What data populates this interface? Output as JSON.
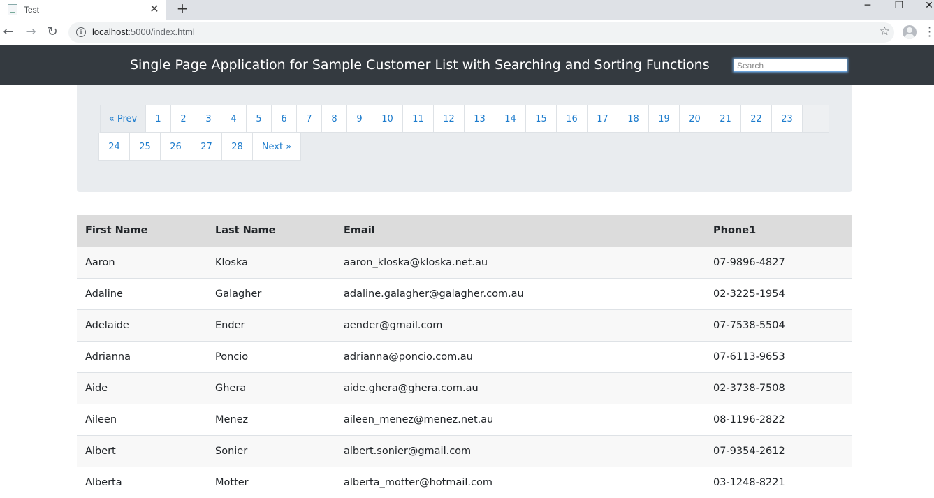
{
  "browser": {
    "tab_title": "Test",
    "new_tab_label": "+",
    "url_host": "localhost",
    "url_path": ":5000/index.html"
  },
  "app": {
    "title": "Single Page Application for Sample Customer List with Searching and Sorting Functions",
    "search_placeholder": "Search"
  },
  "pagination": {
    "row1": [
      "« Prev",
      "1",
      "2",
      "3",
      "4",
      "5",
      "6",
      "7",
      "8",
      "9",
      "10",
      "11",
      "12",
      "13",
      "14",
      "15",
      "16",
      "17",
      "18",
      "19",
      "20",
      "21",
      "22",
      "23"
    ],
    "row2": [
      "24",
      "25",
      "26",
      "27",
      "28",
      "Next »"
    ]
  },
  "table": {
    "columns": [
      "First Name",
      "Last Name",
      "Email",
      "Phone1"
    ],
    "rows": [
      [
        "Aaron",
        "Kloska",
        "aaron_kloska@kloska.net.au",
        "07-9896-4827"
      ],
      [
        "Adaline",
        "Galagher",
        "adaline.galagher@galagher.com.au",
        "02-3225-1954"
      ],
      [
        "Adelaide",
        "Ender",
        "aender@gmail.com",
        "07-7538-5504"
      ],
      [
        "Adrianna",
        "Poncio",
        "adrianna@poncio.com.au",
        "07-6113-9653"
      ],
      [
        "Aide",
        "Ghera",
        "aide.ghera@ghera.com.au",
        "02-3738-7508"
      ],
      [
        "Aileen",
        "Menez",
        "aileen_menez@menez.net.au",
        "08-1196-2822"
      ],
      [
        "Albert",
        "Sonier",
        "albert.sonier@gmail.com",
        "07-9354-2612"
      ],
      [
        "Alberta",
        "Motter",
        "alberta_motter@hotmail.com",
        "03-1248-8221"
      ]
    ]
  }
}
